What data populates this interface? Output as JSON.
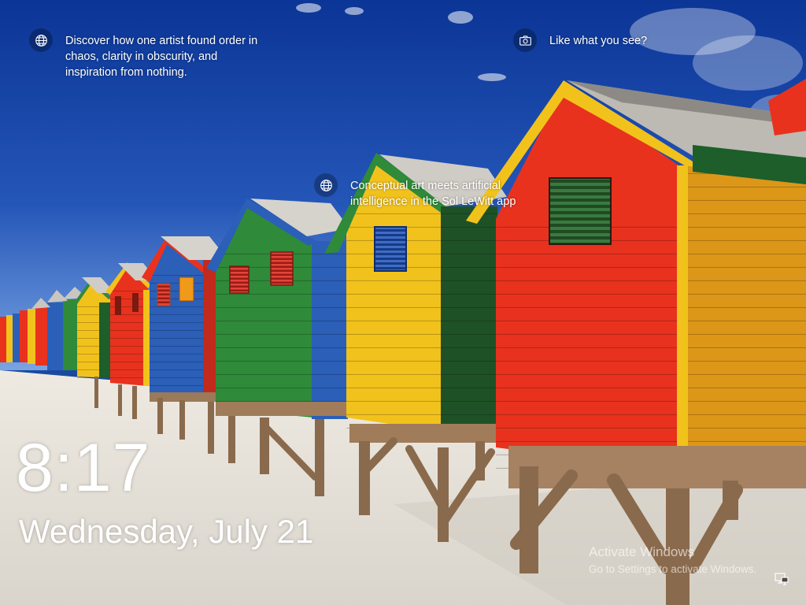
{
  "spotlight": {
    "tip1": {
      "icon": "globe-icon",
      "text": "Discover how one artist found order in chaos, clarity in obscurity, and inspiration from nothing."
    },
    "tip2": {
      "icon": "camera-icon",
      "text": "Like what you see?"
    },
    "tip3": {
      "icon": "globe-icon",
      "text": "Conceptual art meets artificial intelligence in the Sol LeWitt app"
    }
  },
  "clock": {
    "time": "8:17",
    "date": "Wednesday, July 21"
  },
  "activation": {
    "title": "Activate Windows",
    "subtitle": "Go to Settings to activate Windows."
  },
  "status": {
    "network_icon": "network-icon"
  },
  "colors": {
    "sky_top": "#0e3a9c",
    "sky_bottom": "#6f9be0",
    "sand": "#e6e3dc",
    "hut_red": "#e8321e",
    "hut_yellow": "#f2c21c",
    "hut_green": "#2f8a3a",
    "hut_blue": "#2b5fb8"
  }
}
